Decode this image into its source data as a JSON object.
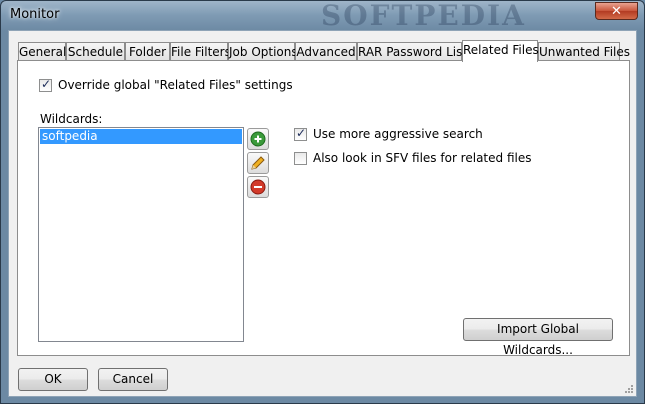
{
  "window": {
    "title": "Monitor",
    "watermark": "SOFTPEDIA",
    "close_glyph": "✕"
  },
  "tabs": [
    {
      "label": "General",
      "active": false
    },
    {
      "label": "Schedule",
      "active": false
    },
    {
      "label": "Folder",
      "active": false
    },
    {
      "label": "File Filters",
      "active": false
    },
    {
      "label": "Job Options",
      "active": false
    },
    {
      "label": "Advanced",
      "active": false
    },
    {
      "label": "RAR Password List",
      "active": false
    },
    {
      "label": "Related Files",
      "active": true
    },
    {
      "label": "Unwanted Files",
      "active": false
    }
  ],
  "panel": {
    "override_label": "Override global \"Related Files\" settings",
    "override_checked": true,
    "wildcards_label": "Wildcards:",
    "wildcards": [
      "softpedia"
    ],
    "aggressive_label": "Use more aggressive search",
    "aggressive_checked": true,
    "sfv_label": "Also look in SFV files for related files",
    "sfv_checked": false,
    "import_label": "Import Global Wildcards..."
  },
  "footer": {
    "ok_label": "OK",
    "cancel_label": "Cancel"
  },
  "icons": {
    "add": "add-icon",
    "edit": "pencil-icon",
    "remove": "remove-icon"
  },
  "colors": {
    "selection": "#3399ff",
    "add": "#3a9a3a",
    "remove": "#d23a2a"
  }
}
